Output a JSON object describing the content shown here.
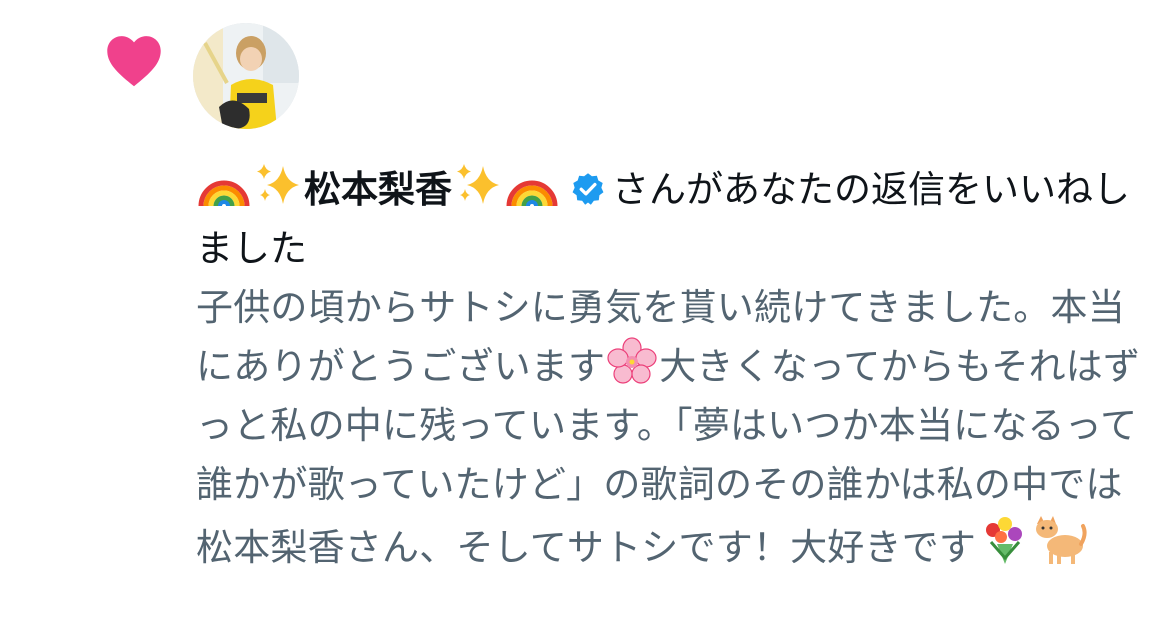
{
  "notification": {
    "type_icon": "heart-icon",
    "accent_color": "#f91880",
    "avatar": "user-avatar",
    "user": {
      "display_name": "松本梨香",
      "leading_emoji": [
        "rainbow-emoji",
        "sparkles-emoji"
      ],
      "trailing_emoji": [
        "sparkles-emoji",
        "rainbow-emoji"
      ],
      "verified": true,
      "verified_color": "#1d9bf0"
    },
    "action_text": "さんがあなたの返信をいいねしました",
    "reply": {
      "segment_1": "子供の頃からサトシに勇気を貰い続けてきました。本当にありがとうございます",
      "emoji_1": "cherry-blossom-emoji",
      "segment_2": "大きくなってからもそれはずっと私の中に残っています。「夢はいつか本当になるって誰かが歌っていたけど」の歌詞のその誰かは私の中では松本梨香さん、そしてサトシです！大好きです",
      "emoji_2": "bouquet-emoji",
      "emoji_3": "cat-emoji"
    }
  }
}
